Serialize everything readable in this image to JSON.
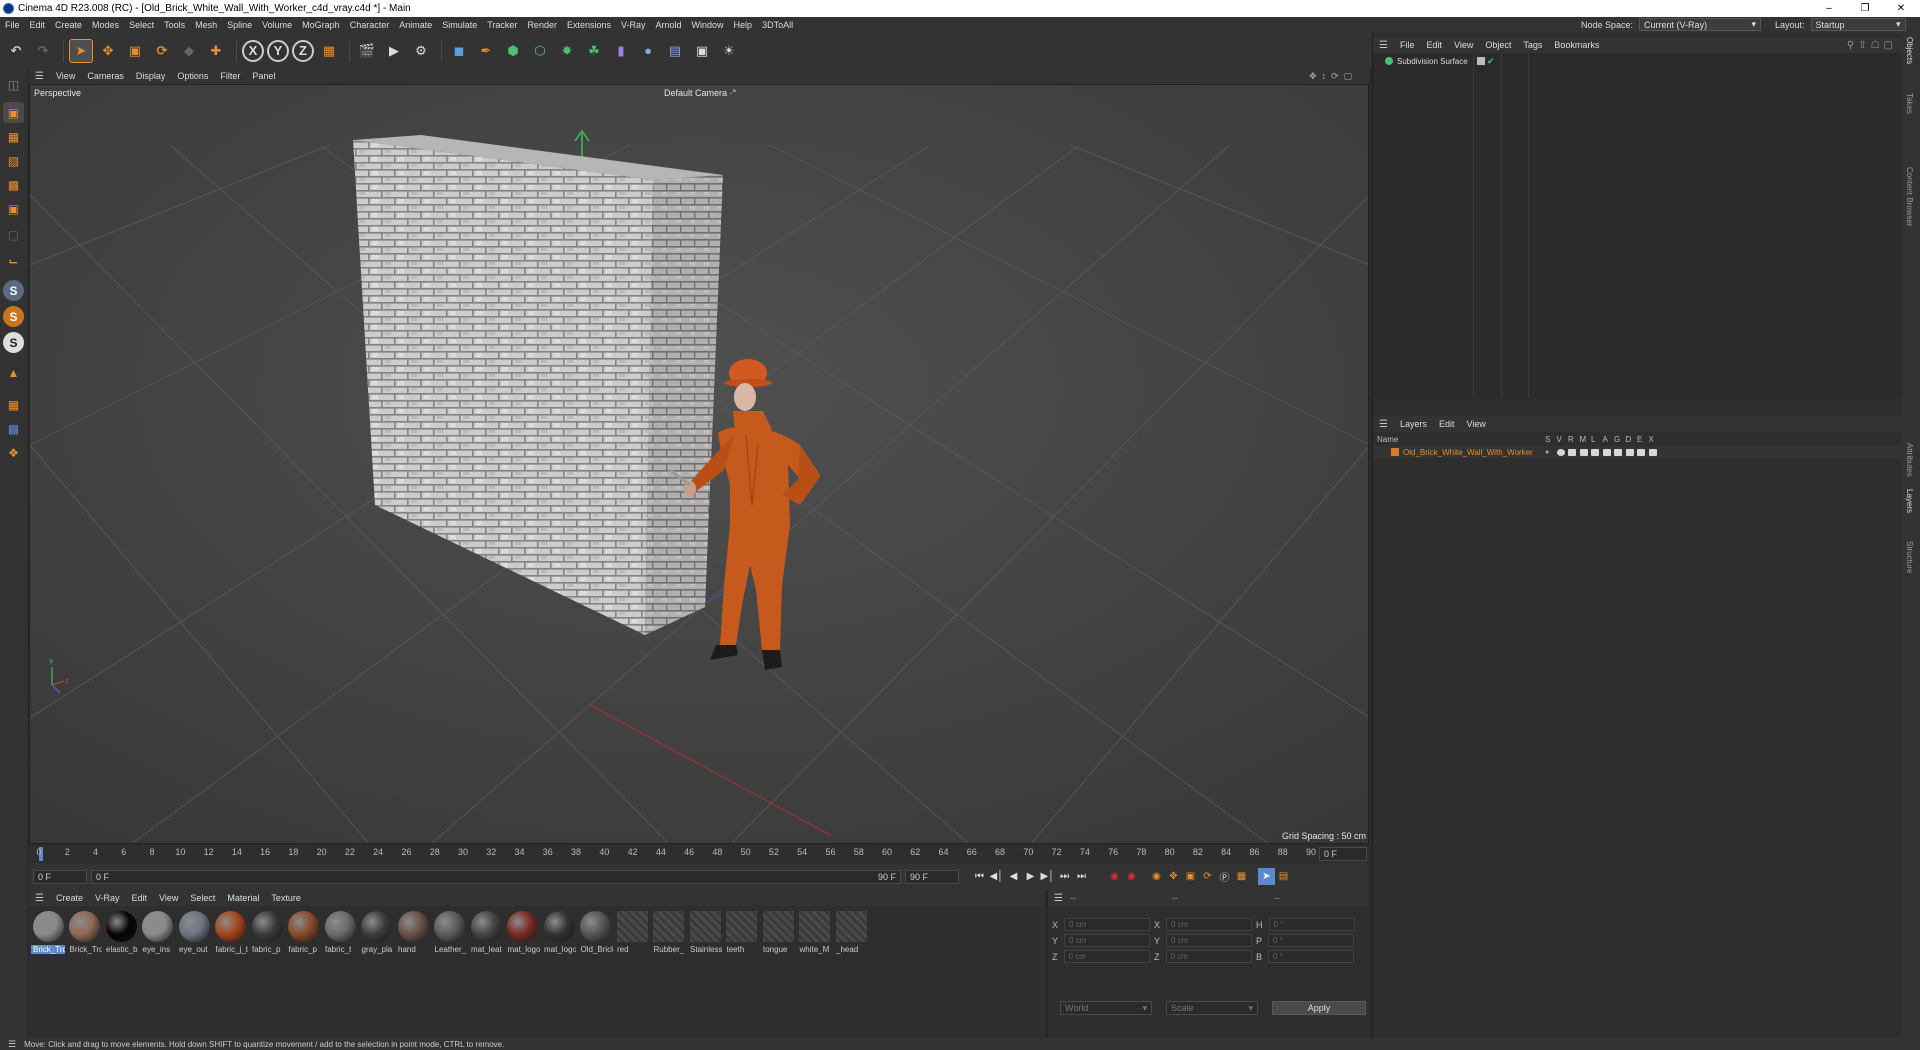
{
  "window": {
    "title": "Cinema 4D R23.008 (RC) - [Old_Brick_White_Wall_With_Worker_c4d_vray.c4d *] - Main",
    "minimize": "–",
    "restore": "❐",
    "close": "✕"
  },
  "menu": [
    "File",
    "Edit",
    "Create",
    "Modes",
    "Select",
    "Tools",
    "Mesh",
    "Spline",
    "Volume",
    "MoGraph",
    "Character",
    "Animate",
    "Simulate",
    "Tracker",
    "Render",
    "Extensions",
    "V-Ray",
    "Arnold",
    "Window",
    "Help",
    "3DToAll"
  ],
  "node_space": {
    "label": "Node Space:",
    "value": "Current (V-Ray)"
  },
  "layout": {
    "label": "Layout:",
    "value": "Startup"
  },
  "viewport": {
    "menu": [
      "View",
      "Cameras",
      "Display",
      "Options",
      "Filter",
      "Panel"
    ],
    "view_name": "Perspective",
    "camera": "Default Camera ·°",
    "grid_spacing": "Grid Spacing : 50 cm"
  },
  "timeline": {
    "ticks": [
      "0",
      "2",
      "4",
      "6",
      "8",
      "10",
      "12",
      "14",
      "16",
      "18",
      "20",
      "22",
      "24",
      "26",
      "28",
      "30",
      "32",
      "34",
      "36",
      "38",
      "40",
      "42",
      "44",
      "46",
      "48",
      "50",
      "52",
      "54",
      "56",
      "58",
      "60",
      "62",
      "64",
      "66",
      "68",
      "70",
      "72",
      "74",
      "76",
      "78",
      "80",
      "82",
      "84",
      "86",
      "88",
      "90"
    ],
    "current_frame": "0 F",
    "start_frame": "0 F",
    "range_start": "0 F",
    "range_end": "90 F",
    "end_frame": "90 F"
  },
  "materials": {
    "menu": [
      "Create",
      "V-Ray",
      "Edit",
      "View",
      "Select",
      "Material",
      "Texture"
    ],
    "items": [
      {
        "label": "Brick_Tro",
        "color": "#8a8a8a"
      },
      {
        "label": "Brick_Tro",
        "color": "#8d6a55"
      },
      {
        "label": "elastic_b",
        "color": "#050505"
      },
      {
        "label": "eye_ins",
        "color": "#8a8a8a"
      },
      {
        "label": "eye_out",
        "color": "#6b7480"
      },
      {
        "label": "fabric_j_t",
        "color": "#a5461b"
      },
      {
        "label": "fabric_p",
        "color": "#3a3a3a"
      },
      {
        "label": "fabric_p",
        "color": "#8a4a28"
      },
      {
        "label": "fabric_t",
        "color": "#6a6a6a"
      },
      {
        "label": "gray_pla",
        "color": "#3c3c3c"
      },
      {
        "label": "hand",
        "color": "#6a5045"
      },
      {
        "label": "Leather_",
        "color": "#5c5c5c"
      },
      {
        "label": "mat_leat",
        "color": "#444444"
      },
      {
        "label": "mat_logo",
        "color": "#7a2a22"
      },
      {
        "label": "mat_logo",
        "color": "#333333"
      },
      {
        "label": "Old_Brick",
        "color": "#555555"
      },
      {
        "label": "red",
        "color": "#4a4a4a"
      },
      {
        "label": "Rubber_",
        "color": "#4a4a4a"
      },
      {
        "label": "Stainless",
        "color": "#4a4a4a"
      },
      {
        "label": "teeth",
        "color": "#4a4a4a"
      },
      {
        "label": "tongue",
        "color": "#4a4a4a"
      },
      {
        "label": "white_M",
        "color": "#4a4a4a"
      },
      {
        "label": "_head",
        "color": "#4a4a4a"
      }
    ]
  },
  "attributes": {
    "header_a": "--",
    "header_b": "--",
    "header_c": "--",
    "rows": [
      {
        "a": "X",
        "av": "0 cm",
        "b": "X",
        "bv": "0 cm",
        "c": "H",
        "cv": "0 °"
      },
      {
        "a": "Y",
        "av": "0 cm",
        "b": "Y",
        "bv": "0 cm",
        "c": "P",
        "cv": "0 °"
      },
      {
        "a": "Z",
        "av": "0 cm",
        "b": "Z",
        "bv": "0 cm",
        "c": "B",
        "cv": "0 °"
      }
    ],
    "coord_mode": "World",
    "size_mode": "Scale",
    "apply": "Apply"
  },
  "objects": {
    "menu": [
      "File",
      "Edit",
      "View",
      "Object",
      "Tags",
      "Bookmarks"
    ],
    "items": [
      {
        "name": "Subdivision Surface"
      }
    ]
  },
  "layers": {
    "menu": [
      "Layers",
      "Edit",
      "View"
    ],
    "column_name": "Name",
    "columns": [
      "S",
      "V",
      "R",
      "M",
      "L",
      "A",
      "G",
      "D",
      "E",
      "X"
    ],
    "items": [
      {
        "name": "Old_Brick_White_Wall_With_Worker",
        "color": "#d97a2a"
      }
    ]
  },
  "side_tabs": [
    "Objects",
    "Takes",
    "Content Browser",
    "Attributes",
    "Layers",
    "Structure"
  ],
  "status": "Move: Click and drag to move elements. Hold down SHIFT to quantize movement / add to the selection in point mode, CTRL to remove.",
  "colors": {
    "accent": "#e8902a",
    "selection": "#5a8ad0",
    "worker": "#c65a1c"
  }
}
